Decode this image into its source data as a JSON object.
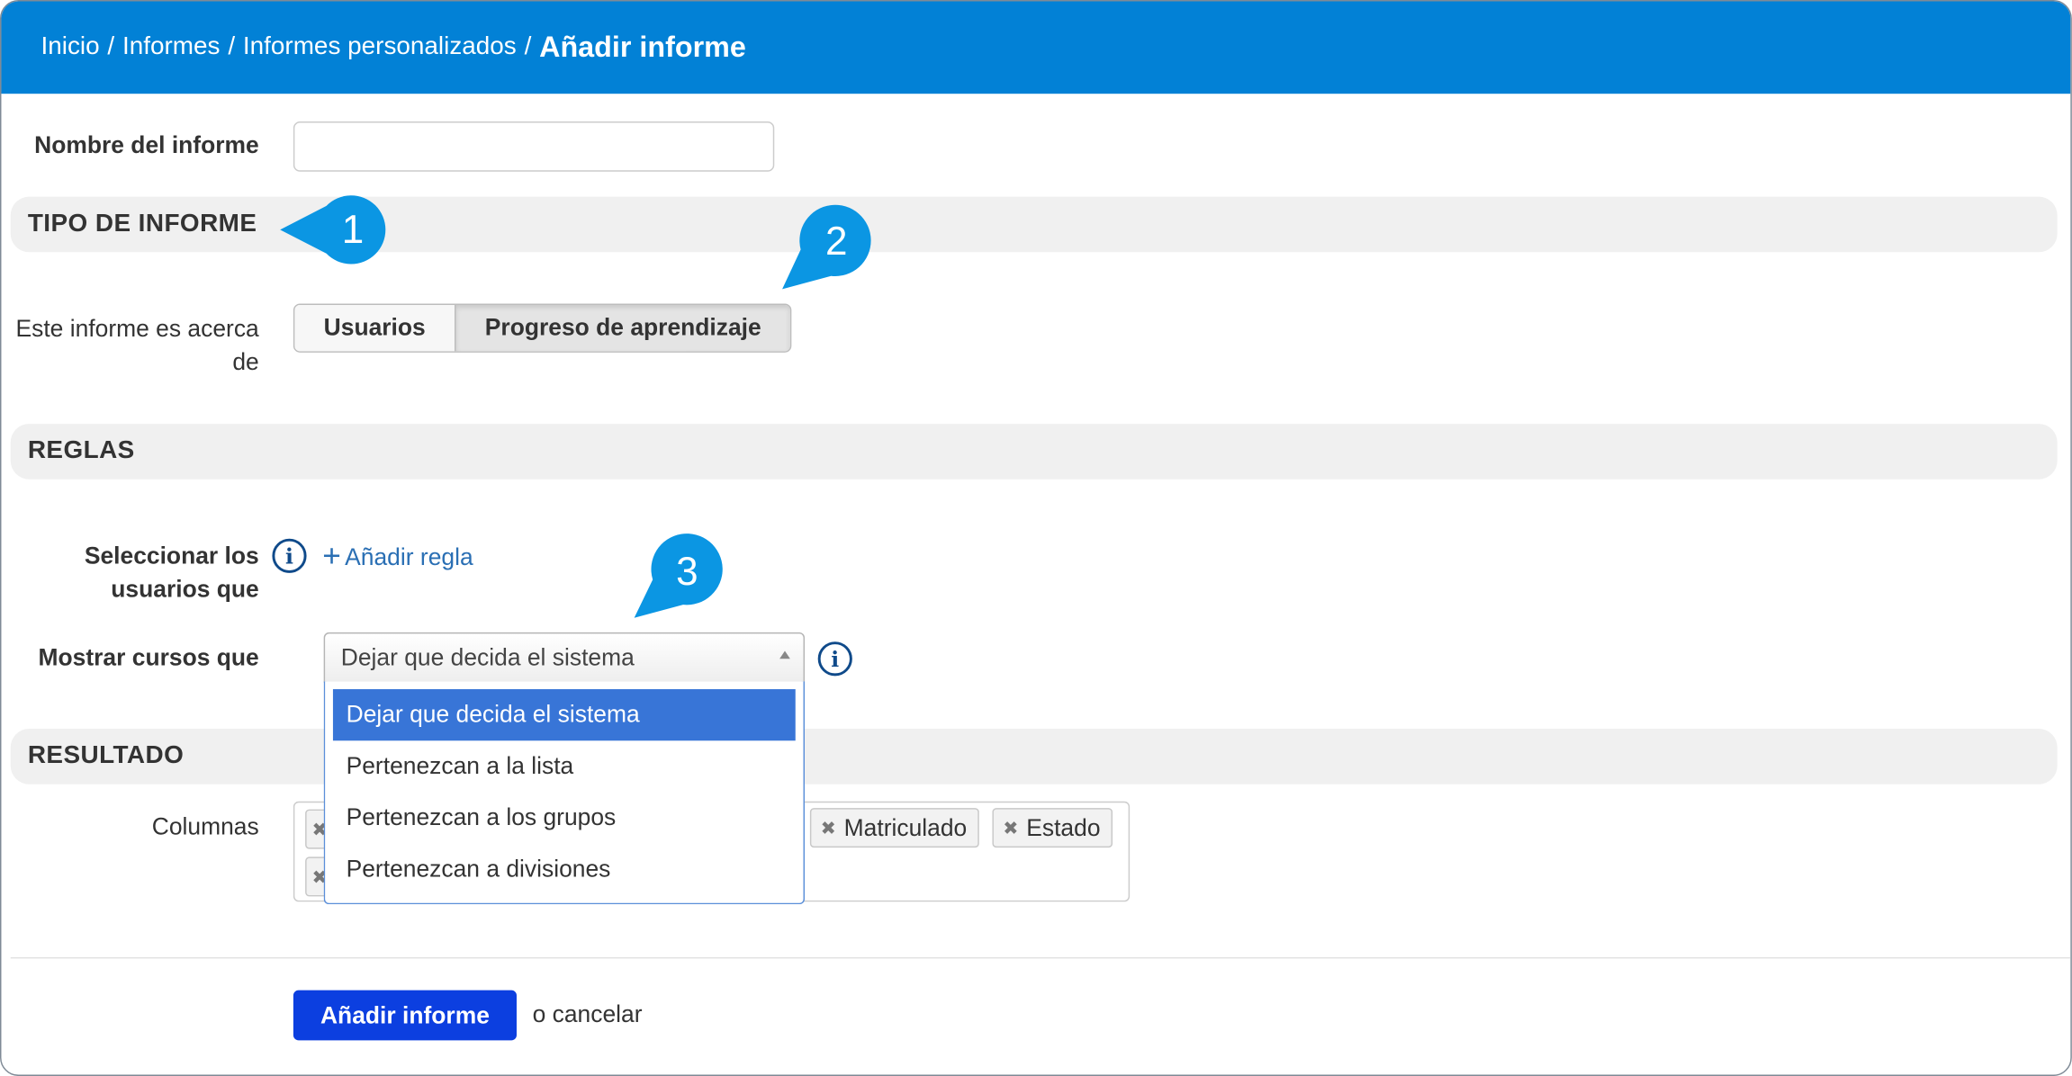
{
  "breadcrumb": {
    "items": [
      "Inicio",
      "Informes",
      "Informes personalizados"
    ],
    "separator": "/",
    "current": "Añadir informe"
  },
  "form": {
    "name_label": "Nombre del informe",
    "name_value": "",
    "about_label_line1": "Este informe es acerca",
    "about_label_line2": "de",
    "about_options": [
      "Usuarios",
      "Progreso de aprendizaje"
    ],
    "about_selected": "Progreso de aprendizaje",
    "select_users_label_line1": "Seleccionar los",
    "select_users_label_line2": "usuarios que",
    "add_rule_label": "Añadir regla",
    "show_courses_label": "Mostrar cursos que",
    "show_courses_value": "Dejar que decida el sistema",
    "show_courses_options": [
      "Dejar que decida el sistema",
      "Pertenezcan a la lista",
      "Pertenezcan a los grupos",
      "Pertenezcan a divisiones"
    ],
    "columns_label": "Columnas",
    "columns_tags": [
      "Matriculado",
      "Estado"
    ]
  },
  "sections": {
    "type": "TIPO DE INFORME",
    "rules": "REGLAS",
    "result": "RESULTADO"
  },
  "actions": {
    "submit_label": "Añadir informe",
    "cancel_label": "o cancelar"
  },
  "callouts": [
    "1",
    "2",
    "3"
  ],
  "colors": {
    "header": "#0281d6",
    "callout": "#0b96e3",
    "primary": "#0c3fe0",
    "selected_option": "#3875d7"
  }
}
